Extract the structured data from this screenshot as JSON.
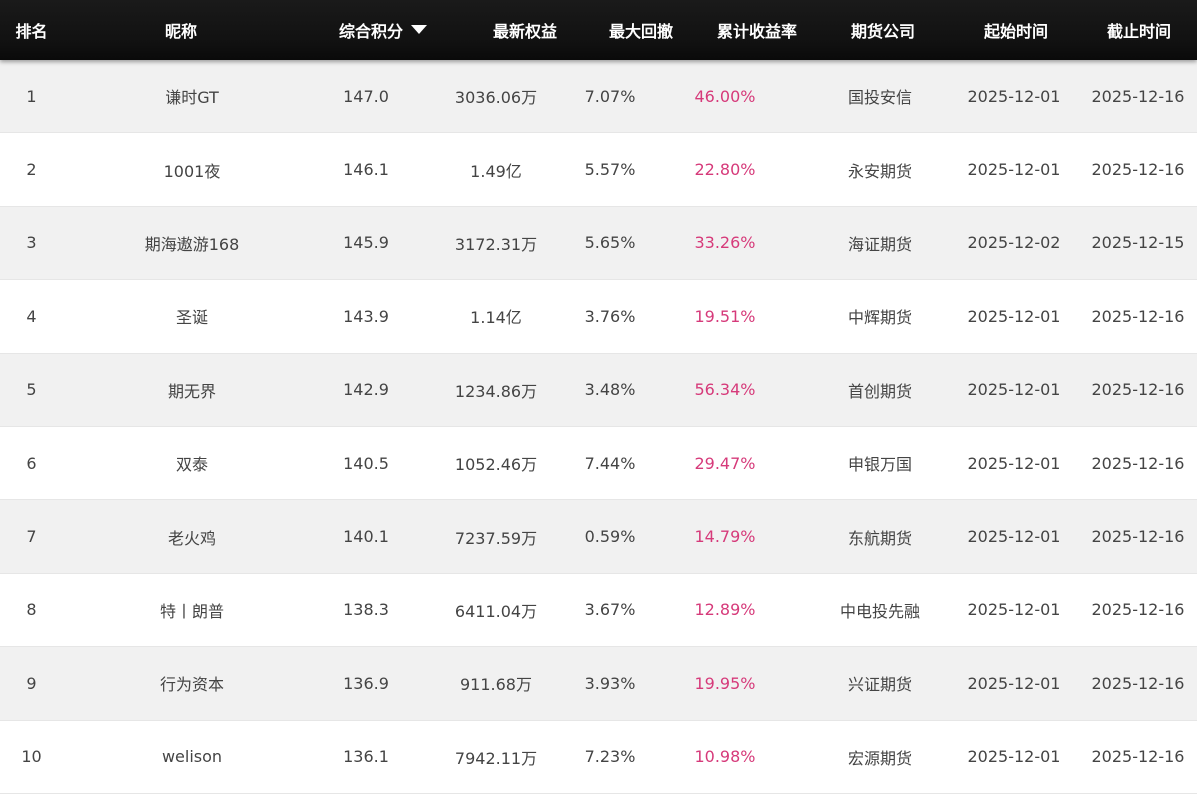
{
  "header": {
    "rank": "排名",
    "nickname": "昵称",
    "score": "综合积分",
    "equity": "最新权益",
    "drawdown": "最大回撤",
    "return_rate": "累计收益率",
    "company": "期货公司",
    "start": "起始时间",
    "end": "截止时间",
    "sort_icon": "caret-down-icon"
  },
  "colors": {
    "header_bg": "#111111",
    "header_text": "#ffffff",
    "row_alt": "#f1f1f1",
    "rate_text": "#d63a7a",
    "body_text": "#444444"
  },
  "rows": [
    {
      "rank": "1",
      "nickname": "谦时GT",
      "score": "147.0",
      "equity": "3036.06万",
      "drawdown": "7.07%",
      "return_rate": "46.00%",
      "company": "国投安信",
      "start": "2025-12-01",
      "end": "2025-12-16"
    },
    {
      "rank": "2",
      "nickname": "1001夜",
      "score": "146.1",
      "equity": "1.49亿",
      "drawdown": "5.57%",
      "return_rate": "22.80%",
      "company": "永安期货",
      "start": "2025-12-01",
      "end": "2025-12-16"
    },
    {
      "rank": "3",
      "nickname": "期海遨游168",
      "score": "145.9",
      "equity": "3172.31万",
      "drawdown": "5.65%",
      "return_rate": "33.26%",
      "company": "海证期货",
      "start": "2025-12-02",
      "end": "2025-12-15"
    },
    {
      "rank": "4",
      "nickname": "圣诞",
      "score": "143.9",
      "equity": "1.14亿",
      "drawdown": "3.76%",
      "return_rate": "19.51%",
      "company": "中辉期货",
      "start": "2025-12-01",
      "end": "2025-12-16"
    },
    {
      "rank": "5",
      "nickname": "期无界",
      "score": "142.9",
      "equity": "1234.86万",
      "drawdown": "3.48%",
      "return_rate": "56.34%",
      "company": "首创期货",
      "start": "2025-12-01",
      "end": "2025-12-16"
    },
    {
      "rank": "6",
      "nickname": "双泰",
      "score": "140.5",
      "equity": "1052.46万",
      "drawdown": "7.44%",
      "return_rate": "29.47%",
      "company": "申银万国",
      "start": "2025-12-01",
      "end": "2025-12-16"
    },
    {
      "rank": "7",
      "nickname": "老火鸡",
      "score": "140.1",
      "equity": "7237.59万",
      "drawdown": "0.59%",
      "return_rate": "14.79%",
      "company": "东航期货",
      "start": "2025-12-01",
      "end": "2025-12-16"
    },
    {
      "rank": "8",
      "nickname": "特丨朗普",
      "score": "138.3",
      "equity": "6411.04万",
      "drawdown": "3.67%",
      "return_rate": "12.89%",
      "company": "中电投先融",
      "start": "2025-12-01",
      "end": "2025-12-16"
    },
    {
      "rank": "9",
      "nickname": "行为资本",
      "score": "136.9",
      "equity": "911.68万",
      "drawdown": "3.93%",
      "return_rate": "19.95%",
      "company": "兴证期货",
      "start": "2025-12-01",
      "end": "2025-12-16"
    },
    {
      "rank": "10",
      "nickname": "welison",
      "score": "136.1",
      "equity": "7942.11万",
      "drawdown": "7.23%",
      "return_rate": "10.98%",
      "company": "宏源期货",
      "start": "2025-12-01",
      "end": "2025-12-16"
    }
  ]
}
